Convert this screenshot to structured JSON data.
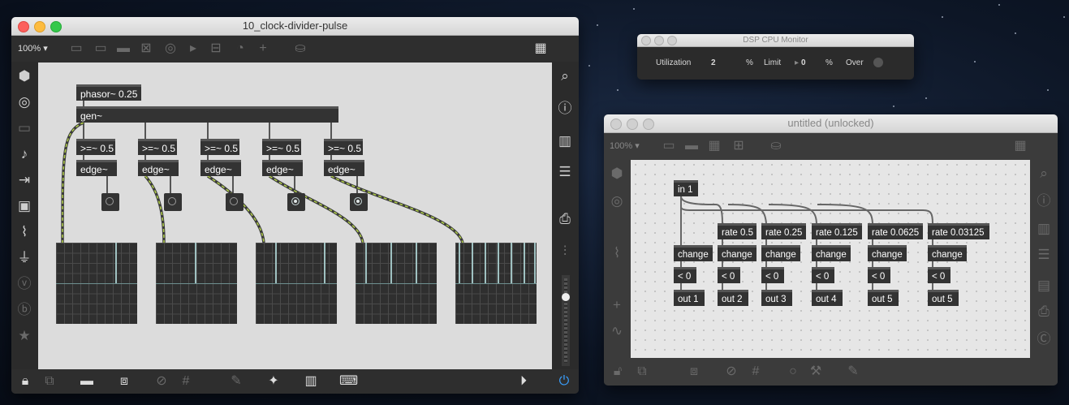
{
  "main_window": {
    "title": "10_clock-divider-pulse",
    "zoom": "100% ▾",
    "objects": {
      "phasor": "phasor~ 0.25",
      "gen": "gen~",
      "comparators": [
        ">=~ 0.5",
        ">=~ 0.5",
        ">=~ 0.5",
        ">=~ 0.5",
        ">=~ 0.5"
      ],
      "edges": [
        "edge~",
        "edge~",
        "edge~",
        "edge~",
        "edge~"
      ]
    },
    "leds_on": [
      false,
      false,
      false,
      true,
      true
    ]
  },
  "dsp_monitor": {
    "title": "DSP CPU Monitor",
    "utilization_label": "Utilization",
    "utilization_value": "2",
    "percent1": "%",
    "limit_label": "Limit",
    "limit_value": "0",
    "percent2": "%",
    "over_label": "Over"
  },
  "untitled_window": {
    "title": "untitled (unlocked)",
    "zoom": "100% ▾",
    "objects": {
      "inlet": "in 1",
      "rates": [
        "rate 0.5",
        "rate 0.25",
        "rate 0.125",
        "rate 0.0625",
        "rate 0.03125"
      ],
      "changes": [
        "change",
        "change",
        "change",
        "change",
        "change",
        "change"
      ],
      "compares": [
        "< 0",
        "< 0",
        "< 0",
        "< 0",
        "< 0",
        "< 0"
      ],
      "outlets": [
        "out 1",
        "out 2",
        "out 3",
        "out 4",
        "out 5",
        "out 5"
      ]
    }
  }
}
